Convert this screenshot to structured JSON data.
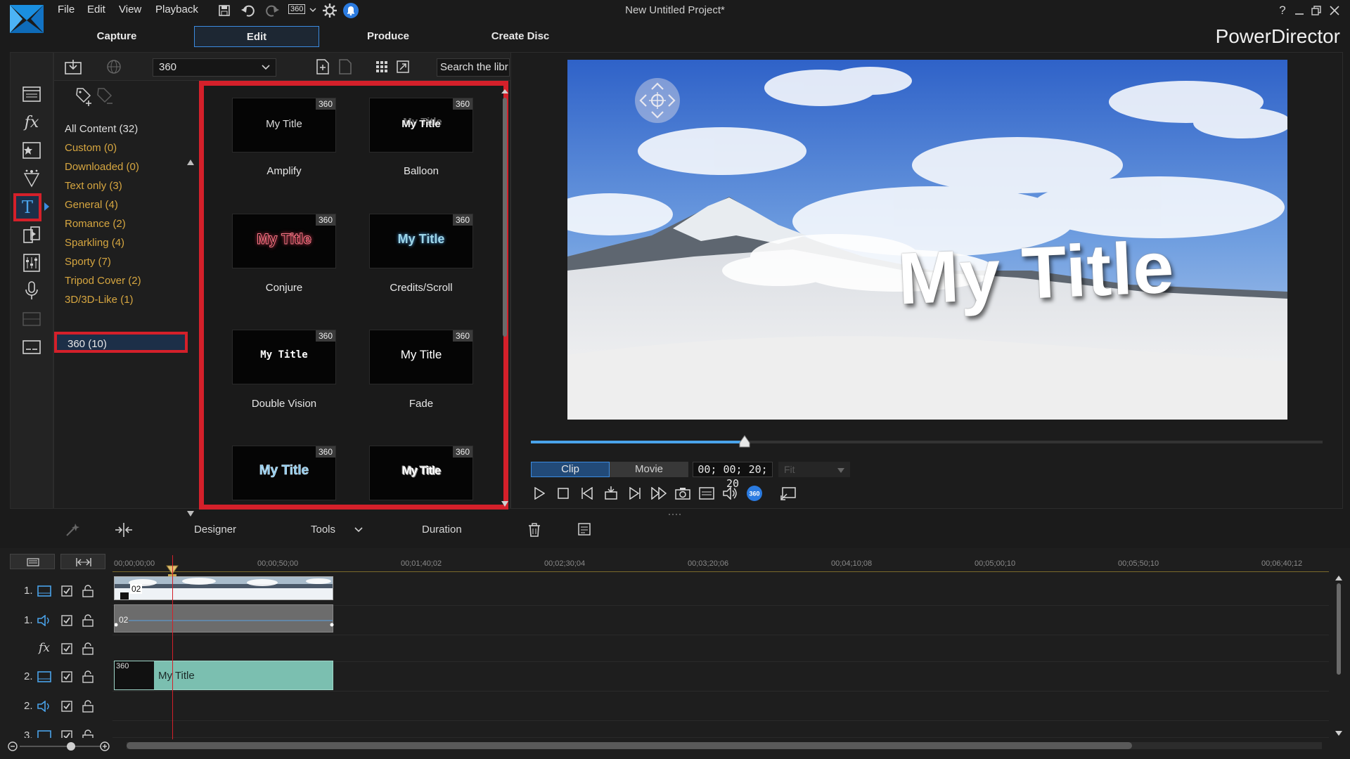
{
  "window": {
    "title": "New Untitled Project*"
  },
  "menu": [
    {
      "id": "file",
      "label": "File"
    },
    {
      "id": "edit",
      "label": "Edit"
    },
    {
      "id": "view",
      "label": "View"
    },
    {
      "id": "playback",
      "label": "Playback"
    }
  ],
  "quick": {
    "mode_360": "360"
  },
  "modes": {
    "capture": "Capture",
    "edit": "Edit",
    "produce": "Produce",
    "create_disc": "Create Disc",
    "active": "Edit"
  },
  "brand": "PowerDirector",
  "library": {
    "filter_value": "360",
    "search_placeholder": "Search the libr",
    "categories": [
      {
        "label": "All Content (32)"
      },
      {
        "label": "Custom  (0)"
      },
      {
        "label": "Downloaded  (0)"
      },
      {
        "label": "Text only  (3)"
      },
      {
        "label": "General  (4)"
      },
      {
        "label": "Romance  (2)"
      },
      {
        "label": "Sparkling  (4)"
      },
      {
        "label": "Sporty  (7)"
      },
      {
        "label": "Tripod Cover  (2)"
      },
      {
        "label": "3D/3D-Like  (1)"
      },
      {
        "label": "360  (10)"
      }
    ],
    "selected_category": "360  (10)",
    "templates": [
      {
        "name": "Amplify",
        "badge": "360",
        "thumb_text": "My Title"
      },
      {
        "name": "Balloon",
        "badge": "360",
        "thumb_text": "My Title"
      },
      {
        "name": "Conjure",
        "badge": "360",
        "thumb_text": "My Title"
      },
      {
        "name": "Credits/Scroll",
        "badge": "360",
        "thumb_text": "My Title"
      },
      {
        "name": "Double Vision",
        "badge": "360",
        "thumb_text": "My Title"
      },
      {
        "name": "Fade",
        "badge": "360",
        "thumb_text": "My Title"
      },
      {
        "name": "",
        "badge": "360",
        "thumb_text": "My Title"
      },
      {
        "name": "",
        "badge": "360",
        "thumb_text": "My Title"
      }
    ]
  },
  "preview": {
    "overlay_title": "My Title",
    "clip_label": "Clip",
    "movie_label": "Movie",
    "timecode": "00; 00; 20; 20",
    "fit_label": "Fit",
    "mode_active": "Clip",
    "scrub_fraction": 0.27
  },
  "timeline_toolbar": {
    "designer": "Designer",
    "tools": "Tools",
    "duration": "Duration"
  },
  "timeline": {
    "ruler": [
      "00;00;00;00",
      "00;00;50;00",
      "00;01;40;02",
      "00;02;30;04",
      "00;03;20;06",
      "00;04;10;08",
      "00;05;00;10",
      "00;05;50;10",
      "00;06;40;12"
    ],
    "tracks": [
      {
        "num": "1.",
        "kind": "video-icon"
      },
      {
        "num": "1.",
        "kind": "audio-icon"
      },
      {
        "num": "",
        "kind": "fx-icon"
      },
      {
        "num": "2.",
        "kind": "video-icon"
      },
      {
        "num": "2.",
        "kind": "audio-icon"
      },
      {
        "num": "3.",
        "kind": "video-icon"
      }
    ],
    "clips": {
      "video_label": "02",
      "audio_label": "02",
      "title_badge": "360",
      "title_text": "My Title"
    }
  },
  "colors": {
    "accent_blue": "#3b8be0",
    "highlight_red": "#d4202a",
    "category_orange": "#d6a640",
    "title_clip": "#7bbfb0"
  }
}
